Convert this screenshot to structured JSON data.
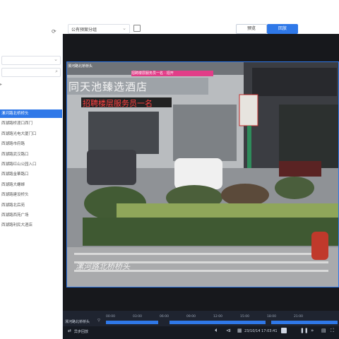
{
  "header": {
    "group_select_value": "公有预案分组",
    "preview_label": "预览",
    "playback_label": "回放"
  },
  "sidebar": {
    "items": [
      {
        "label": "漯河路北桥桥头",
        "selected": true
      },
      {
        "label": "西湖路桥渡口西门"
      },
      {
        "label": "西湖路光电大厦门口"
      },
      {
        "label": "西湖路市府路"
      },
      {
        "label": "西湖路武汉路口"
      },
      {
        "label": "西湖路红山公园入口"
      },
      {
        "label": "西湖路金華路口"
      },
      {
        "label": "西湖路大螺蛳"
      },
      {
        "label": "西湖路建设桥头"
      },
      {
        "label": "西湖路北后苑"
      },
      {
        "label": "西湖路西苑广场"
      },
      {
        "label": "西湖路利民大酒店"
      }
    ]
  },
  "video": {
    "camera_title": "漯河路北桥桥头",
    "osd_text": "招聘楼层服务员一名 · 招开",
    "hotel_sign": "同天池臻选酒店",
    "banner_text": "招聘楼层服务员一名",
    "corner_overlay": "漯河路北桥桥头"
  },
  "timeline": {
    "channel_label": "漯河路北桥桥头",
    "ticks": [
      "00:00",
      "03:00",
      "06:00",
      "09:00",
      "12:00",
      "15:00",
      "18:00",
      "21:00"
    ],
    "sync_playback_label": "异步回放",
    "datetime": "23/10/14 17:03:41"
  }
}
